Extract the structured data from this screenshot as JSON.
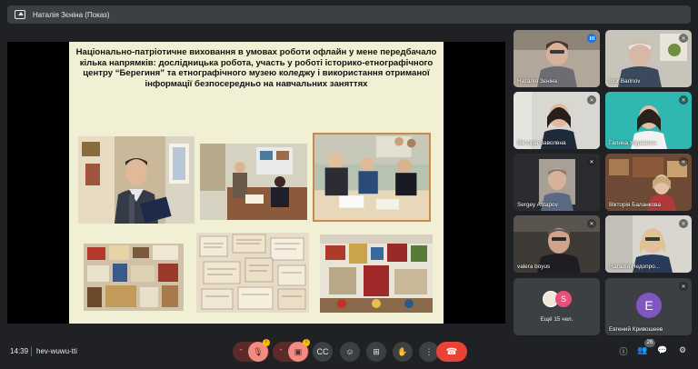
{
  "window": {
    "presenting_title": "Наталія Зєніна (Показ)"
  },
  "slide": {
    "title": "Національно-патріотичне виховання  в умовах роботи офлайн у мене передбачало кілька напрямків: дослідницька робота, участь у роботі історико-етнографічного центру “Берегиня” та етнографічного музею коледжу і використання отриманої інформації безпосередньо на навчальних заняттях"
  },
  "participants": [
    {
      "name": "Наталія Зєніна",
      "state": "speaking",
      "active": true
    },
    {
      "name": "Igor Barinov",
      "state": "muted"
    },
    {
      "name": "Вікторія Заволвна",
      "state": "muted"
    },
    {
      "name": "Галина Журавель",
      "state": "muted"
    },
    {
      "name": "Sergey Astapov",
      "state": "muted"
    },
    {
      "name": "Вікторія Баланкова",
      "state": "muted"
    },
    {
      "name": "valera boyus",
      "state": "muted"
    },
    {
      "name": "Наталія Недопро...",
      "state": "muted"
    }
  ],
  "more": {
    "label": "Ещё 15 чел.",
    "avatar_letter": "S"
  },
  "last_participant": {
    "name": "Евгений Кривошеев",
    "initial": "E"
  },
  "bottom": {
    "time": "14:39",
    "meeting_code": "hev-wuwu-tti",
    "people_count": "26"
  },
  "colors": {
    "background": "#202124",
    "slide_bg": "#f2f0d4",
    "muted_red": "#f28b82",
    "hangup_red": "#ea4335",
    "active_blue": "#8ab4f8",
    "avatar_purple": "#7e57c2"
  },
  "icons": {
    "mic": "mic-off-icon",
    "camera": "camera-off-icon",
    "captions": "captions-icon",
    "emoji": "emoji-icon",
    "present": "present-now-icon",
    "raise_hand": "raise-hand-icon",
    "more": "more-options-icon",
    "hang_up": "hang-up-icon",
    "info": "info-icon",
    "people": "people-icon",
    "chat": "chat-icon",
    "activities": "activities-icon"
  }
}
